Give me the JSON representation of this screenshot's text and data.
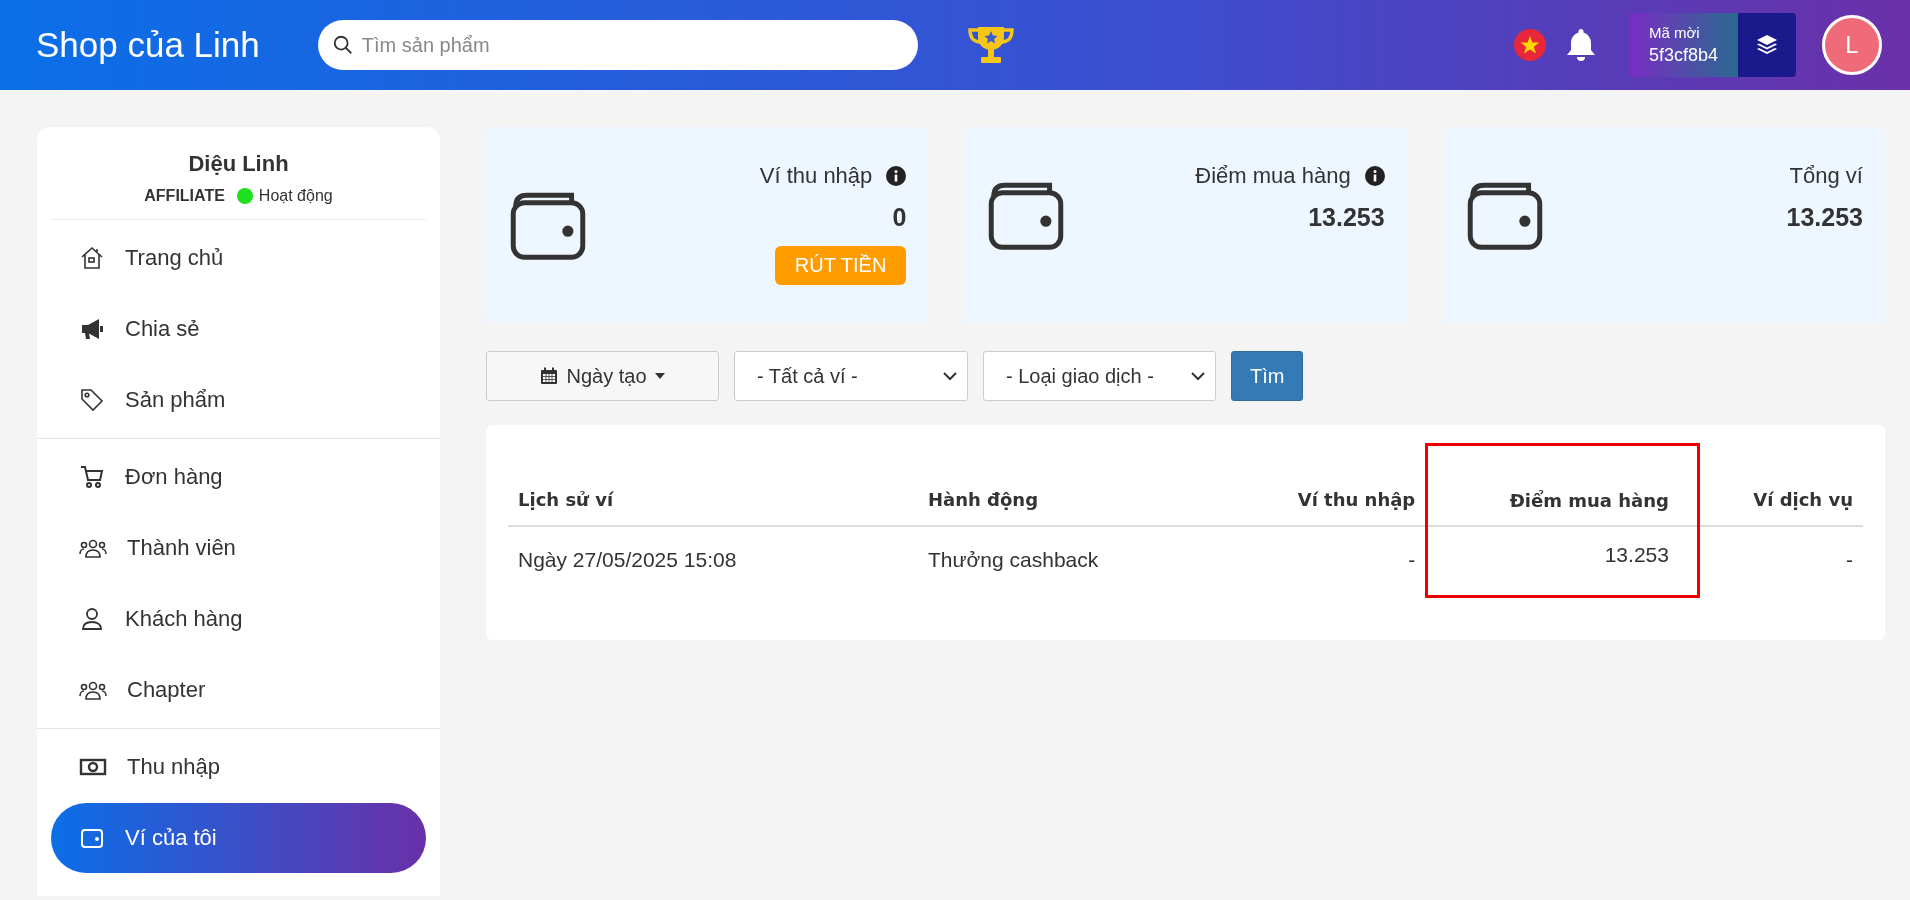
{
  "header": {
    "title": "Shop của Linh",
    "search": {
      "placeholder": "Tìm sản phẩm"
    },
    "invite": {
      "label": "Mã mời",
      "code": "5f3cf8b4"
    },
    "avatar": "L"
  },
  "profile": {
    "name": "Diệu Linh",
    "role": "AFFILIATE",
    "status": "Hoạt động",
    "online": true
  },
  "sidebar": {
    "groups": [
      [
        {
          "label": "Trang chủ",
          "selected": false
        },
        {
          "label": "Chia sẻ",
          "selected": false
        },
        {
          "label": "Sản phẩm",
          "selected": false
        }
      ],
      [
        {
          "label": "Đơn hàng",
          "selected": false
        },
        {
          "label": "Thành viên",
          "selected": false
        },
        {
          "label": "Khách hàng",
          "selected": false
        },
        {
          "label": "Chapter",
          "selected": false
        }
      ],
      [
        {
          "label": "Thu nhập",
          "selected": false
        },
        {
          "label": "Ví của tôi",
          "selected": true
        }
      ]
    ]
  },
  "cards": [
    {
      "label": "Ví thu nhập",
      "info": true,
      "value": "0",
      "button": "RÚT TIỀN"
    },
    {
      "label": "Điểm mua hàng",
      "info": true,
      "value": "13.253"
    },
    {
      "label": "Tổng ví",
      "info": false,
      "value": "13.253"
    }
  ],
  "filters": {
    "date": "Ngày tạo",
    "wallet": "- Tất cả ví -",
    "type": "- Loại giao dịch -",
    "search_button": "Tìm"
  },
  "table": {
    "columns": [
      {
        "label": "Lịch sử ví",
        "highlighted": false
      },
      {
        "label": "Hành động",
        "highlighted": false
      },
      {
        "label": "Ví thu nhập",
        "highlighted": false
      },
      {
        "label": "Điểm mua hàng",
        "highlighted": true
      },
      {
        "label": "Ví dịch vụ",
        "highlighted": false
      }
    ],
    "rows": [
      [
        "Ngày 27/05/2025 15:08",
        "Thưởng cashback",
        "-",
        "13.253",
        "-"
      ]
    ]
  }
}
